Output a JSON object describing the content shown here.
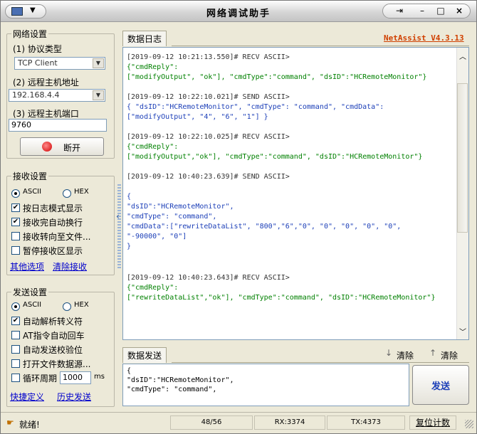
{
  "window": {
    "title": "网络调试助手"
  },
  "title_controls": {
    "pin": "⇥",
    "minimize": "–",
    "maximize": "□",
    "close": "×"
  },
  "net_settings": {
    "title": "网络设置",
    "protocol_label": "(1) 协议类型",
    "protocol_value": "TCP Client",
    "host_label": "(2) 远程主机地址",
    "host_value": "192.168.4.4",
    "port_label": "(3) 远程主机端口",
    "port_value": "9760",
    "connect_button": "断开"
  },
  "recv_settings": {
    "title": "接收设置",
    "ascii": "ASCII",
    "hex": "HEX",
    "options": [
      {
        "label": "按日志模式显示",
        "checked": true
      },
      {
        "label": "接收完自动换行",
        "checked": true
      },
      {
        "label": "接收转向至文件...",
        "checked": false
      },
      {
        "label": "暂停接收区显示",
        "checked": false
      }
    ],
    "more_link": "其他选项",
    "clear_link": "清除接收"
  },
  "send_settings": {
    "title": "发送设置",
    "ascii": "ASCII",
    "hex": "HEX",
    "options": [
      {
        "label": "自动解析转义符",
        "checked": true
      },
      {
        "label": "AT指令自动回车",
        "checked": false
      },
      {
        "label": "自动发送校验位",
        "checked": false
      },
      {
        "label": "打开文件数据源...",
        "checked": false
      }
    ],
    "cycle_label": "循环周期",
    "cycle_value": "1000",
    "cycle_unit": "ms",
    "shortcut_link": "快捷定义",
    "history_link": "历史发送"
  },
  "log": {
    "tab": "数据日志",
    "version": "NetAssist V4.3.13",
    "lines": [
      {
        "cls": "meta",
        "text": "[2019-09-12 10:21:13.550]# RECV ASCII>"
      },
      {
        "cls": "green",
        "text": "{\"cmdReply\":"
      },
      {
        "cls": "green",
        "text": "[\"modifyOutput\", \"ok\"], \"cmdType\":\"command\", \"dsID\":\"HCRemoteMonitor\"}"
      },
      {
        "cls": "meta",
        "text": "[2019-09-12 10:22:10.021]# SEND ASCII>"
      },
      {
        "cls": "blue",
        "text": "{ \"dsID\":\"HCRemoteMonitor\", \"cmdType\": \"command\", \"cmdData\":"
      },
      {
        "cls": "blue",
        "text": "[\"modifyOutput\", \"4\", \"6\", \"1\"] }"
      },
      {
        "cls": "meta",
        "text": "[2019-09-12 10:22:10.025]# RECV ASCII>"
      },
      {
        "cls": "green",
        "text": "{\"cmdReply\":"
      },
      {
        "cls": "green",
        "text": "[\"modifyOutput\",\"ok\"], \"cmdType\":\"command\", \"dsID\":\"HCRemoteMonitor\"}"
      },
      {
        "cls": "meta",
        "text": "[2019-09-12 10:40:23.639]# SEND ASCII>"
      },
      {
        "cls": "blue",
        "text": "{"
      },
      {
        "cls": "blue",
        "text": "\"dsID\":\"HCRemoteMonitor\","
      },
      {
        "cls": "blue",
        "text": "\"cmdType\": \"command\","
      },
      {
        "cls": "blue",
        "text": "\"cmdData\":[\"rewriteDataList\", \"800\",\"6\",\"0\", \"0\", \"0\", \"0\", \"0\","
      },
      {
        "cls": "blue",
        "text": "\"-90000\", \"0\"]"
      },
      {
        "cls": "blue",
        "text": "}"
      },
      {
        "cls": "meta",
        "text": "[2019-09-12 10:40:23.643]# RECV ASCII>"
      },
      {
        "cls": "green",
        "text": "{\"cmdReply\":"
      },
      {
        "cls": "green",
        "text": "[\"rewriteDataList\",\"ok\"], \"cmdType\":\"command\", \"dsID\":\"HCRemoteMonitor\"}"
      }
    ]
  },
  "send": {
    "tab": "数据发送",
    "clear1": "清除",
    "clear2": "清除",
    "lines": [
      "{",
      "\"dsID\":\"HCRemoteMonitor\",",
      "\"cmdType\": \"command\","
    ],
    "send_button": "发送"
  },
  "status": {
    "ready": "就绪!",
    "counter": "48/56",
    "rx": "RX:3374",
    "tx": "TX:4373",
    "reset": "复位计数"
  },
  "colors": {
    "log_blue": "#1c3fb8",
    "log_green": "#008000",
    "version": "#d04000"
  },
  "icons": [
    "app-icon",
    "dropdown-arrow-icon",
    "connect-status-icon",
    "collapse-arrow-icon",
    "scroll-up-icon",
    "scroll-down-icon",
    "clear-down-icon",
    "clear-up-icon",
    "status-icon"
  ]
}
